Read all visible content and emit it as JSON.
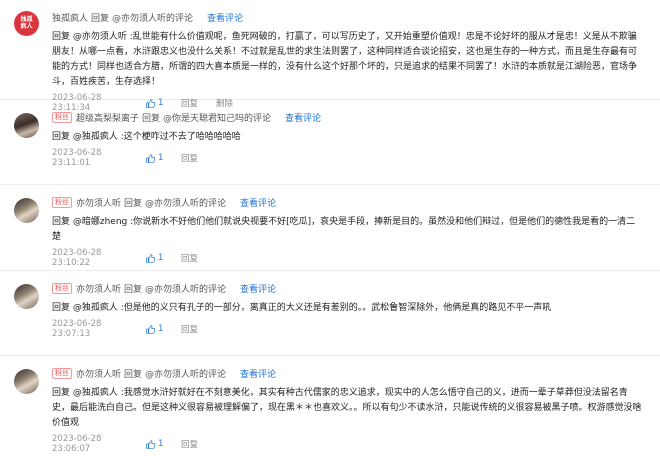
{
  "comments": [
    {
      "user": "独孤疯人",
      "tag": "",
      "reply_word": "回复",
      "target": "@亦勿须人听的评论",
      "view_link": "查看评论",
      "text": "回复 @亦勿须人听 :乱世能有什么价值观呢，鱼死网破的，打赢了，可以写历史了，又开始重塑价值观！忠是不论好坏的服从才是忠！义是从不欺骗朋友！从哪一点看，水浒跟忠义也没什么关系！不过就是乱世的求生法则罢了，这种同样适合谈论招安，这也是生存的一种方式，而且是生存最有可能的方式！同样也适合方腊，所谓的四大喜本质是一样的，没有什么这个好那个坏的，只是追求的结果不同罢了！水浒的本质就是江湖险恶，官场争斗，百姓疾苦，生存选择！",
      "time": "2023-06-28 23:11:34",
      "likes": "1",
      "actions": [
        "回复",
        "删除"
      ],
      "avatar_icon": "red-seal-avatar"
    },
    {
      "user": "超级高梨梨离子",
      "tag": "粉丝",
      "reply_word": "回复",
      "target": "@你是天聪君知己吗的评论",
      "view_link": "查看评论",
      "text": "回复 @独孤疯人 :这个梗咋过不去了哈哈哈哈哈",
      "time": "2023-06-28 23:11:01",
      "likes": "1",
      "actions": [
        "回复"
      ],
      "avatar_icon": "person-avatar"
    },
    {
      "user": "亦勿须人听",
      "tag": "粉丝",
      "reply_word": "回复",
      "target": "@亦勿须人听的评论",
      "view_link": "查看评论",
      "text": "回复 @暗娜zheng :你说新水不好他们他们就说央视要不好[吃瓜]，哀央是手段，捧新是目的。虽然没和他们辩过，但是他们的德性我是看的一清二楚",
      "time": "2023-06-28 23:10:22",
      "likes": "1",
      "actions": [
        "回复"
      ],
      "avatar_icon": "person-avatar"
    },
    {
      "user": "亦勿须人听",
      "tag": "粉丝",
      "reply_word": "回复",
      "target": "@亦勿须人听的评论",
      "view_link": "查看评论",
      "text": "回复 @独孤疯人 :但是他的义只有孔子的一部分，离真正的大义还是有差别的。。武松鲁智深除外，他俩是真的路见不平一声吼",
      "time": "2023-06-28 23:07:13",
      "likes": "1",
      "actions": [
        "回复"
      ],
      "avatar_icon": "person-avatar"
    },
    {
      "user": "亦勿须人听",
      "tag": "粉丝",
      "reply_word": "回复",
      "target": "@亦勿须人听的评论",
      "view_link": "查看评论",
      "text": "回复 @独孤疯人 :我感觉水浒好就好在不刻意美化，其实有种古代儒家的忠义追求，现实中的人怎么悟守自己的义，进而一辈子草莽但没法留名青史，最后能洗白自己。但是这种义很容易被理解偏了，现在黑＊＊也喜欢义。。所以有句少不读水浒，只能说传统的义很容易被黑子喷。权游感觉没啥价值观",
      "time": "2023-06-28 23:06:07",
      "likes": "1",
      "actions": [
        "回复"
      ],
      "avatar_icon": "person-avatar"
    }
  ],
  "colors": {
    "link": "#1e73d8",
    "tag": "#e55a5a",
    "like": "#2c7ad6"
  }
}
